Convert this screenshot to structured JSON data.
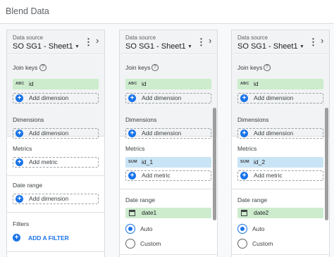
{
  "app": {
    "title": "Blend Data"
  },
  "labels": {
    "data_source": "Data source",
    "join_keys": "Join keys",
    "dimensions": "Dimensions",
    "metrics": "Metrics",
    "date_range": "Date range",
    "filters": "Filters",
    "add_dimension": "Add dimension",
    "add_metric": "Add metric",
    "add_filter": "ADD A FILTER",
    "auto": "Auto",
    "custom": "Custom",
    "plus": "+",
    "kebab": "⋮",
    "chevron": "›",
    "caret": "▼",
    "help": "?"
  },
  "panels": [
    {
      "source_name": "SO SG1 - Sheet1",
      "join_key": {
        "type_badge": "ABC",
        "field": "id"
      },
      "date_range_dimension_label": "Add dimension"
    },
    {
      "source_name": "SO SG1 - Sheet1",
      "join_key": {
        "type_badge": "ABC",
        "field": "id"
      },
      "metric": {
        "type_badge": "SUM",
        "field": "id_1"
      },
      "date_field": "date1",
      "date_mode": "Auto"
    },
    {
      "source_name": "SO SG1 - Sheet1",
      "join_key": {
        "type_badge": "ABC",
        "field": "id"
      },
      "metric": {
        "type_badge": "SUM",
        "field": "id_2"
      },
      "date_field": "date2",
      "date_mode": "Auto"
    }
  ],
  "colors": {
    "accent": "#1a73e8",
    "join_key_chip": "#cdeccd",
    "metric_chip": "#c9e4f5"
  }
}
